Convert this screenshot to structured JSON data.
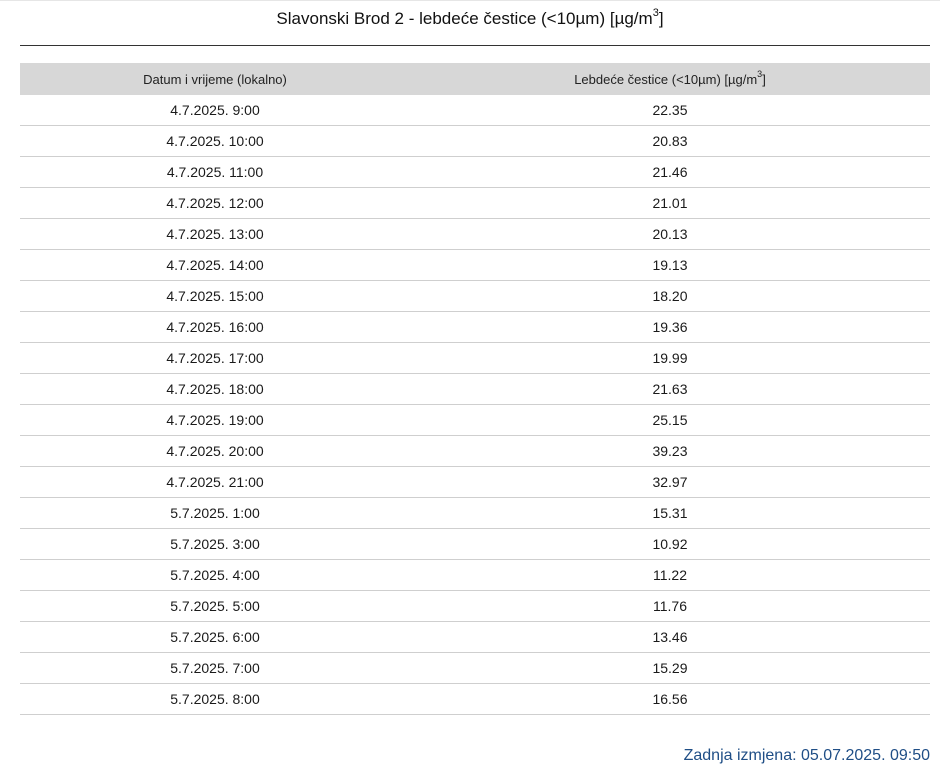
{
  "title": {
    "text": "Slavonski Brod 2 - lebdeće čestice (<10µm) [µg/m",
    "sup": "3",
    "suffix": "]"
  },
  "table": {
    "headers": {
      "time": "Datum i vrijeme (lokalno)",
      "value": "Lebdeće čestice (<10µm) [µg/m",
      "value_sup": "3",
      "value_suffix": "]"
    },
    "rows": [
      {
        "time": "4.7.2025. 9:00",
        "value": "22.35"
      },
      {
        "time": "4.7.2025. 10:00",
        "value": "20.83"
      },
      {
        "time": "4.7.2025. 11:00",
        "value": "21.46"
      },
      {
        "time": "4.7.2025. 12:00",
        "value": "21.01"
      },
      {
        "time": "4.7.2025. 13:00",
        "value": "20.13"
      },
      {
        "time": "4.7.2025. 14:00",
        "value": "19.13"
      },
      {
        "time": "4.7.2025. 15:00",
        "value": "18.20"
      },
      {
        "time": "4.7.2025. 16:00",
        "value": "19.36"
      },
      {
        "time": "4.7.2025. 17:00",
        "value": "19.99"
      },
      {
        "time": "4.7.2025. 18:00",
        "value": "21.63"
      },
      {
        "time": "4.7.2025. 19:00",
        "value": "25.15"
      },
      {
        "time": "4.7.2025. 20:00",
        "value": "39.23"
      },
      {
        "time": "4.7.2025. 21:00",
        "value": "32.97"
      },
      {
        "time": "5.7.2025. 1:00",
        "value": "15.31"
      },
      {
        "time": "5.7.2025. 3:00",
        "value": "10.92"
      },
      {
        "time": "5.7.2025. 4:00",
        "value": "11.22"
      },
      {
        "time": "5.7.2025. 5:00",
        "value": "11.76"
      },
      {
        "time": "5.7.2025. 6:00",
        "value": "13.46"
      },
      {
        "time": "5.7.2025. 7:00",
        "value": "15.29"
      },
      {
        "time": "5.7.2025. 8:00",
        "value": "16.56"
      }
    ]
  },
  "footer": {
    "last_modified": "Zadnja izmjena: 05.07.2025. 09:50"
  },
  "colors": {
    "header_bg": "#d7d7d7",
    "footer_text": "#1f4e86"
  }
}
